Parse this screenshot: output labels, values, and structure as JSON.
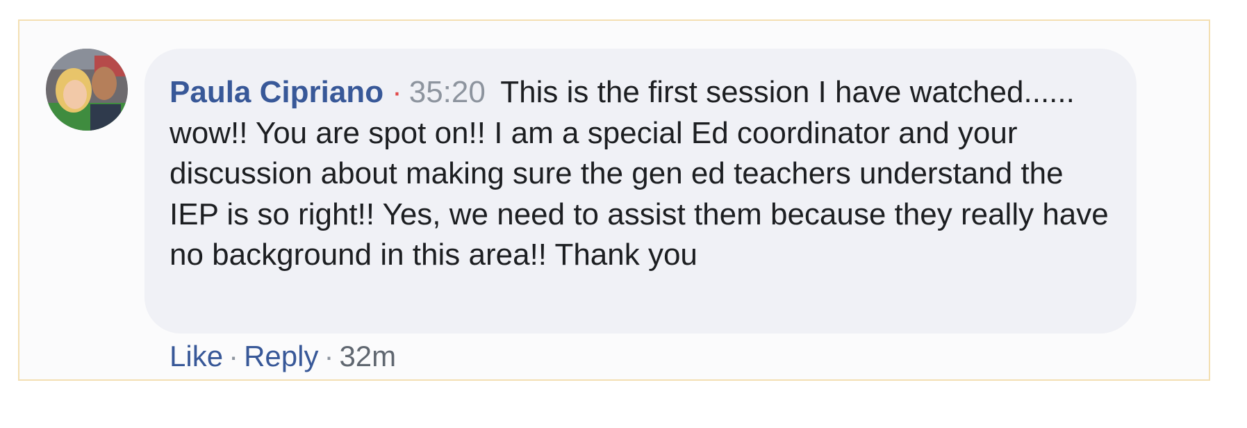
{
  "comment": {
    "author": "Paula Cipriano",
    "separator": "·",
    "video_timestamp": "35:20",
    "text": "This is the first session I have watched...... wow!! You are spot on!! I am a special Ed coordinator and your discussion about making sure the gen ed teachers understand the IEP is so right!! Yes, we need to assist them because they really have no background in this area!! Thank you"
  },
  "actions": {
    "like_label": "Like",
    "reply_label": "Reply",
    "separator": "·",
    "age": "32m"
  },
  "avatar": {
    "icon": "profile-photo-avatar"
  },
  "colors": {
    "author_link": "#385898",
    "bubble_bg": "#f0f1f6",
    "frame_border": "#f3dfb2",
    "timestamp": "#8d949e",
    "separator_dot": "#e24a4a"
  }
}
